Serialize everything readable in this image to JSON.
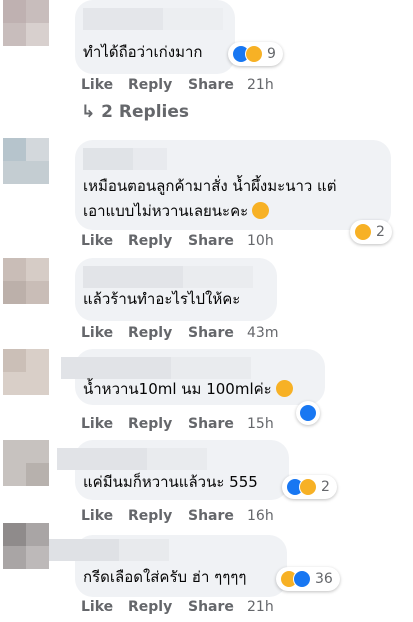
{
  "comments": [
    {
      "text_lines": [
        "ทำได้ถือว่าเก่งมาก"
      ],
      "like_label": "Like",
      "reply_label": "Reply",
      "share_label": "Share",
      "time": "21h",
      "reaction_count": "9",
      "reaction_icons": [
        "like-icon",
        "laugh-icon"
      ]
    },
    {
      "text_lines": [
        "เหมือนตอนลูกค้ามาสั่ง น้ำผึ้งมะนาว แต่",
        "เอาแบบไม่หวานเลยนะคะ"
      ],
      "like_label": "Like",
      "reply_label": "Reply",
      "share_label": "Share",
      "time": "10h",
      "reaction_count": "2",
      "reaction_icons": [
        "laugh-icon"
      ]
    },
    {
      "text_lines": [
        "แล้วร้านทำอะไรไปให้คะ"
      ],
      "like_label": "Like",
      "reply_label": "Reply",
      "share_label": "Share",
      "time": "43m",
      "reaction_count": "",
      "reaction_icons": []
    },
    {
      "text_lines": [
        "น้ำหวาน10ml นม 100mlค่ะ"
      ],
      "like_label": "Like",
      "reply_label": "Reply",
      "share_label": "Share",
      "time": "15h",
      "reaction_count": "",
      "reaction_icons": [
        "like-icon"
      ]
    },
    {
      "text_lines": [
        "แค่มีนมก็หวานแล้วนะ 555"
      ],
      "like_label": "Like",
      "reply_label": "Reply",
      "share_label": "Share",
      "time": "16h",
      "reaction_count": "2",
      "reaction_icons": [
        "like-icon",
        "laugh-icon"
      ]
    },
    {
      "text_lines": [
        "กรีดเลือดใส่ครับ ฮ่า ๆๆๆๆ"
      ],
      "like_label": "Like",
      "reply_label": "Reply",
      "share_label": "Share",
      "time": "21h",
      "reaction_count": "36",
      "reaction_icons": [
        "laugh-icon",
        "like-icon"
      ]
    }
  ],
  "replies_link": {
    "arrow": "↳",
    "label": "2 Replies"
  },
  "colors": {
    "bubble": "#f0f2f5",
    "action_text": "#65676b",
    "like_blue": "#1877f2",
    "laugh_yellow": "#f7b125"
  }
}
